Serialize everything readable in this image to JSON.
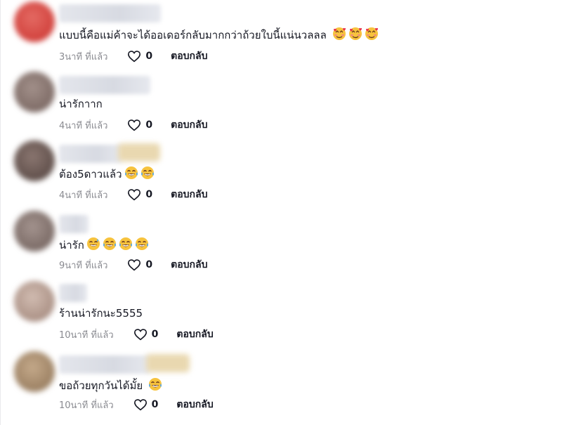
{
  "comments": [
    {
      "text": "แบบนี้คือแม่ค้าจะได้ออเดอร์กลับมากกว่าถ้วยใบนี้แน่นวลลล",
      "emojis": [
        "smiling-face-with-hearts",
        "smiling-face-with-hearts",
        "smiling-face-with-hearts"
      ],
      "time": "3นาที ที่แล้ว",
      "likes": "0",
      "reply": "ตอบกลับ",
      "avatar_color": "#d9534f"
    },
    {
      "text": "น่ารักาาก",
      "emojis": [],
      "time": "4นาที ที่แล้ว",
      "likes": "0",
      "reply": "ตอบกลับ",
      "avatar_color": "#8a7670"
    },
    {
      "text": "ต้อง5ดาวแล้ว",
      "emojis": [
        "face-with-tears-of-joy",
        "face-with-tears-of-joy"
      ],
      "time": "4นาที ที่แล้ว",
      "likes": "0",
      "reply": "ตอบกลับ",
      "avatar_color": "#6d5a55"
    },
    {
      "text": "น่ารัก",
      "emojis": [
        "grinning-face-with-sweat",
        "face-with-tears-of-joy",
        "face-with-tears-of-joy",
        "face-with-tears-of-joy"
      ],
      "time": "9นาที ที่แล้ว",
      "likes": "0",
      "reply": "ตอบกลับ",
      "avatar_color": "#8c7d78"
    },
    {
      "text": "ร้านน่ารักนะ5555",
      "emojis": [],
      "time": "10นาที ที่แล้ว",
      "likes": "0",
      "reply": "ตอบกลับ",
      "avatar_color": "#b59a8e"
    },
    {
      "text": "ขอถ้วยทุกวันได้มั้ย",
      "emojis": [
        "face-with-tears-of-joy"
      ],
      "time": "10นาที ที่แล้ว",
      "likes": "0",
      "reply": "ตอบกลับ",
      "avatar_color": "#a38a6e"
    }
  ]
}
